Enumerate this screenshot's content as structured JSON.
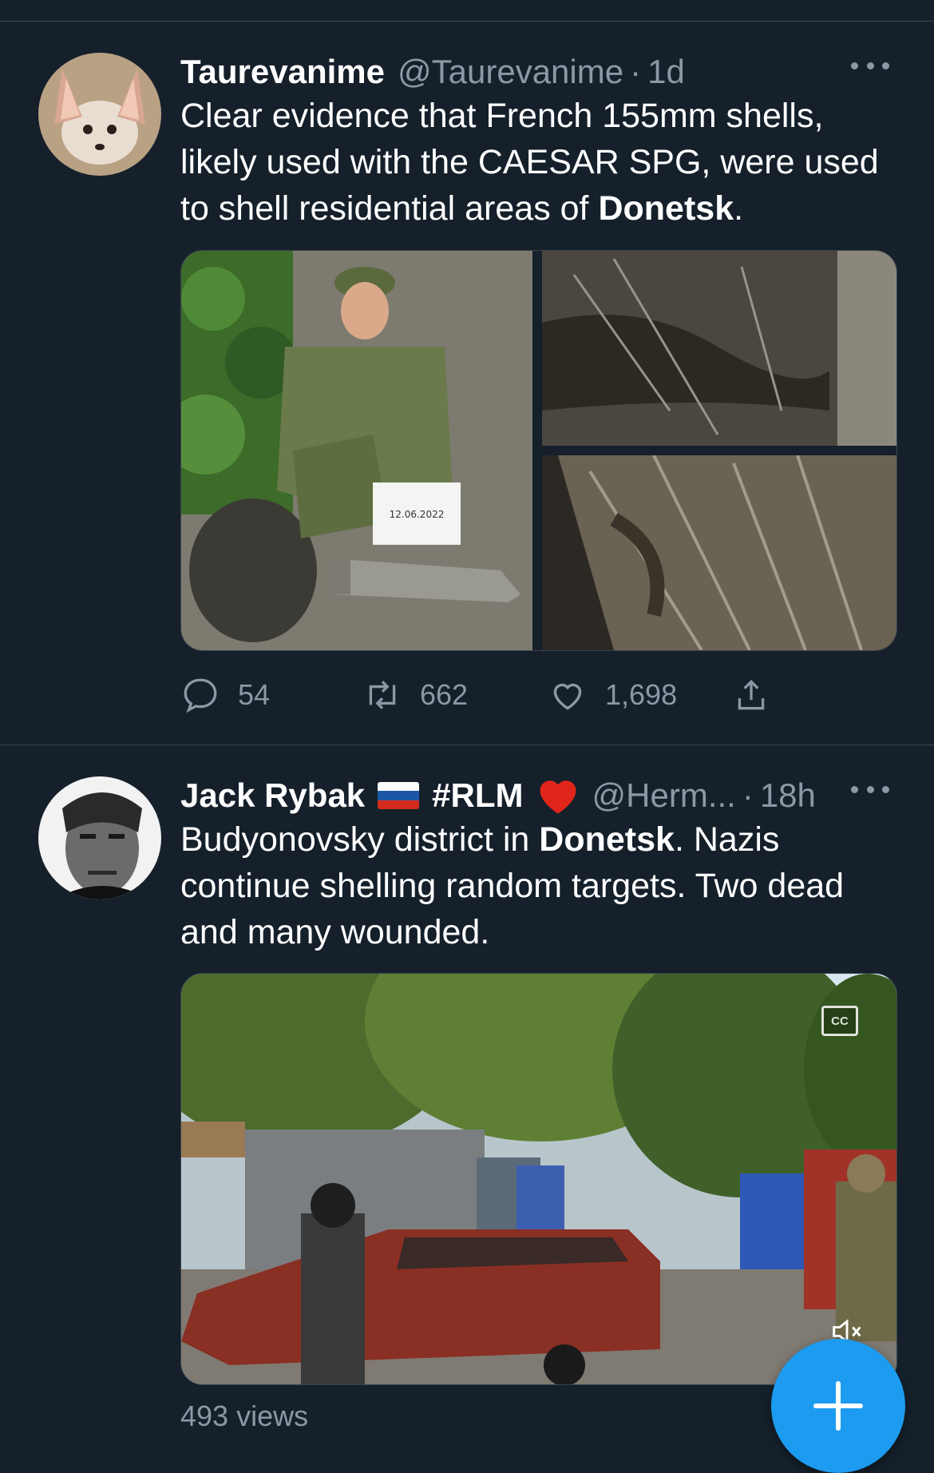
{
  "tweets": [
    {
      "display_name": "Taurevanime",
      "handle": "@Taurevanime",
      "separator": "·",
      "time": "1d",
      "text_before": "Clear evidence that French 155mm shells, likely used with the CAESAR SPG, were used to shell residential areas of ",
      "text_bold": "Donetsk",
      "text_after": ".",
      "photo_sign_text": "12.06.2022",
      "stats": {
        "replies": "54",
        "retweets": "662",
        "likes": "1,698"
      }
    },
    {
      "display_name": "Jack Rybak",
      "hashtag": "#RLM",
      "handle": "@Herm...",
      "separator": "·",
      "time": "18h",
      "text_before": "Budyonovsky district in ",
      "text_bold": "Donetsk",
      "text_after": ". Nazis continue shelling random targets. Two dead and many wounded.",
      "views": "493 views",
      "video_cc_label": "CC"
    }
  ],
  "icons": {
    "reply": "reply-icon",
    "retweet": "retweet-icon",
    "like": "heart-icon",
    "share": "share-icon",
    "more": "more-icon",
    "compose": "plus-icon",
    "captions": "captions-off-icon",
    "mute": "mute-icon"
  },
  "colors": {
    "background": "#15202b",
    "text_secondary": "#8b98a5",
    "accent": "#1d9bf0",
    "divider": "#38444d"
  }
}
